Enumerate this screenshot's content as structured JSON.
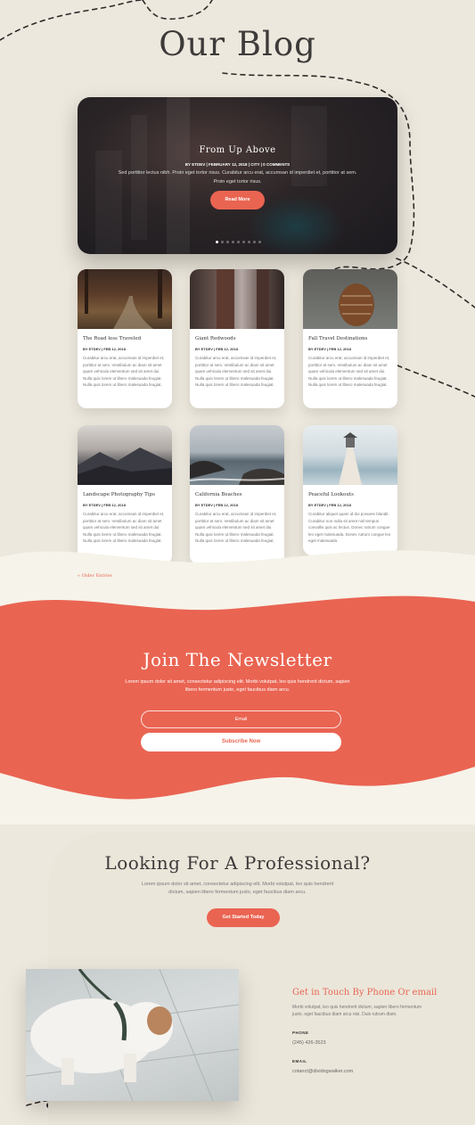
{
  "page": {
    "title": "Our Blog"
  },
  "hero": {
    "title": "From Up Above",
    "meta": "BY ETDEV | FEBRUARY 12, 2018 | CITY | 0 COMMENTS",
    "text": "Sed porttitor lectus nibh. Proin eget tortor risus. Curabitur arcu erat, accumsan id imperdiet et, porttitor at sem. Proin eget tortor risus.",
    "button": "Read More",
    "slide_count": 9,
    "active_slide": 1
  },
  "posts": [
    {
      "title": "The Road less Traveled",
      "meta": "BY ETDEV | FEB 12, 2018",
      "text": "Curabitur arcu erat, accumsan id imperdiet et, porttitor at sem. Vestibulum ac diam sit amet quam vehicula elementum sed sit amet dui. Nulla quis lorem ut libero malesuada feugiat. Nulla quis lorem ut libero malesuada feugiat."
    },
    {
      "title": "Giant Redwoods",
      "meta": "BY ETDEV | FEB 12, 2018",
      "text": "Curabitur arcu erat, accumsan id imperdiet et, porttitor at sem. Vestibulum ac diam sit amet quam vehicula elementum sed sit amet dui. Nulla quis lorem ut libero malesuada feugiat. Nulla quis lorem ut libero malesuada feugiat."
    },
    {
      "title": "Fall Travel Destinations",
      "meta": "BY ETDEV | FEB 12, 2018",
      "text": "Curabitur arcu erat, accumsan id imperdiet et, porttitor at sem. Vestibulum ac diam sit amet quam vehicula elementum sed sit amet dui. Nulla quis lorem ut libero malesuada feugiat. Nulla quis lorem ut libero malesuada feugiat."
    },
    {
      "title": "Landscape Photography Tips",
      "meta": "BY ETDEV | FEB 12, 2018",
      "text": "Curabitur arcu erat, accumsan id imperdiet et, porttitor at sem. Vestibulum ac diam sit amet quam vehicula elementum sed sit amet dui. Nulla quis lorem ut libero malesuada feugiat. Nulla quis lorem ut libero malesuada feugiat."
    },
    {
      "title": "California Beaches",
      "meta": "BY ETDEV | FEB 12, 2018",
      "text": "Curabitur arcu erat, accumsan id imperdiet et, porttitor at sem. Vestibulum ac diam sit amet quam vehicula elementum sed sit amet dui. Nulla quis lorem ut libero malesuada feugiat. Nulla quis lorem ut libero malesuada feugiat."
    },
    {
      "title": "Peaceful Lookouts",
      "meta": "BY ETDEV | FEB 12, 2018",
      "text": "Curabitur aliquet quam id dui posuere blandit. Curabitur non nulla sit amet nisl tempus convallis quis ac lectus. Donec rutrum congue leo eget malesuada. Donec rutrum congue leo eget malesuada."
    }
  ],
  "older_entries": "« Older Entries",
  "newsletter": {
    "title": "Join The Newsletter",
    "text": "Lorem ipsum dolor sit amet, consectetur adipiscing elit. Morbi volutpat, leo quis hendrerit dictum, sapien libero fermentum justo, eget faucibus diam arcu.",
    "email_placeholder": "Email",
    "button": "Subscribe Now"
  },
  "professional": {
    "title": "Looking For A Professional?",
    "text": "Lorem ipsum dolor sit amet, consectetur adipiscing elit. Morbi volutpat, leo quis hendrerit dictum, sapien libero fermentum justo, eget faucibus diam arcu.",
    "button": "Get Started Today"
  },
  "contact": {
    "title": "Get in Touch By Phone Or email",
    "text": "Morbi volutpat, leo quis hendrerit dictum, sapien libero fermentum justo, eget faucibus diam arcu nisi. Duis rutrum diam.",
    "phone_label": "PHONE",
    "phone": "(245) 426-3523",
    "email_label": "EMAIL",
    "email": "cotanct@dividogwalker.com"
  },
  "colors": {
    "accent": "#ea6452",
    "background": "#ede8dd",
    "cream": "#f6f3ea",
    "dark_text": "#3d3a3a"
  }
}
